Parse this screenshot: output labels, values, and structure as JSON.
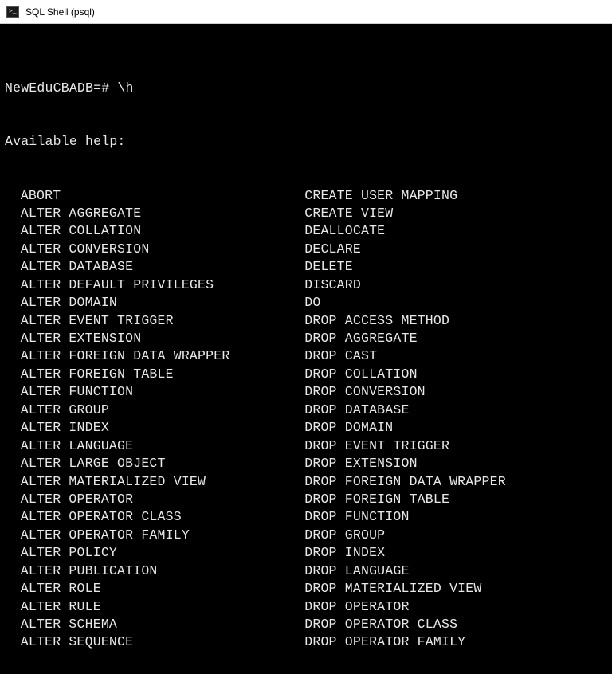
{
  "window": {
    "title": "SQL Shell (psql)"
  },
  "terminal": {
    "promptLine": "NewEduCBADB=# \\h",
    "availableLabel": "Available help:",
    "leftColumn": [
      "ABORT",
      "ALTER AGGREGATE",
      "ALTER COLLATION",
      "ALTER CONVERSION",
      "ALTER DATABASE",
      "ALTER DEFAULT PRIVILEGES",
      "ALTER DOMAIN",
      "ALTER EVENT TRIGGER",
      "ALTER EXTENSION",
      "ALTER FOREIGN DATA WRAPPER",
      "ALTER FOREIGN TABLE",
      "ALTER FUNCTION",
      "ALTER GROUP",
      "ALTER INDEX",
      "ALTER LANGUAGE",
      "ALTER LARGE OBJECT",
      "ALTER MATERIALIZED VIEW",
      "ALTER OPERATOR",
      "ALTER OPERATOR CLASS",
      "ALTER OPERATOR FAMILY",
      "ALTER POLICY",
      "ALTER PUBLICATION",
      "ALTER ROLE",
      "ALTER RULE",
      "ALTER SCHEMA",
      "ALTER SEQUENCE"
    ],
    "rightColumn": [
      "CREATE USER MAPPING",
      "CREATE VIEW",
      "DEALLOCATE",
      "DECLARE",
      "DELETE",
      "DISCARD",
      "DO",
      "DROP ACCESS METHOD",
      "DROP AGGREGATE",
      "DROP CAST",
      "DROP COLLATION",
      "DROP CONVERSION",
      "DROP DATABASE",
      "DROP DOMAIN",
      "DROP EVENT TRIGGER",
      "DROP EXTENSION",
      "DROP FOREIGN DATA WRAPPER",
      "DROP FOREIGN TABLE",
      "DROP FUNCTION",
      "DROP GROUP",
      "DROP INDEX",
      "DROP LANGUAGE",
      "DROP MATERIALIZED VIEW",
      "DROP OPERATOR",
      "DROP OPERATOR CLASS",
      "DROP OPERATOR FAMILY"
    ]
  }
}
